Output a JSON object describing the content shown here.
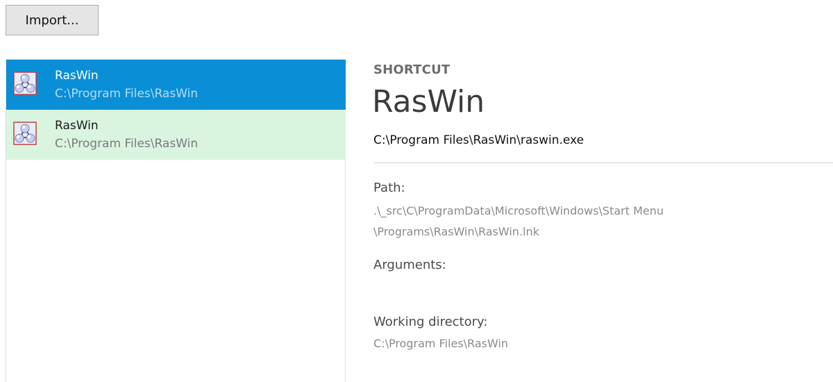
{
  "toolbar": {
    "import_label": "Import..."
  },
  "list": {
    "items": [
      {
        "title": "RasWin",
        "subtitle": "C:\\Program Files\\RasWin",
        "icon": "raswin-app-icon",
        "state": "selected"
      },
      {
        "title": "RasWin",
        "subtitle": "C:\\Program Files\\RasWin",
        "icon": "raswin-app-icon",
        "state": "highlighted"
      }
    ]
  },
  "detail": {
    "kind": "SHORTCUT",
    "name": "RasWin",
    "target": "C:\\Program Files\\RasWin\\raswin.exe",
    "path_label": "Path:",
    "path_line1": ".\\_src\\C\\ProgramData\\Microsoft\\Windows\\Start Menu",
    "path_line2": "\\Programs\\RasWin\\RasWin.lnk",
    "arguments_label": "Arguments:",
    "arguments_value": "",
    "workdir_label": "Working directory:",
    "workdir_value": "C:\\Program Files\\RasWin"
  },
  "colors": {
    "selected_bg": "#0a8fd6",
    "highlight_bg": "#d9f5e0"
  }
}
